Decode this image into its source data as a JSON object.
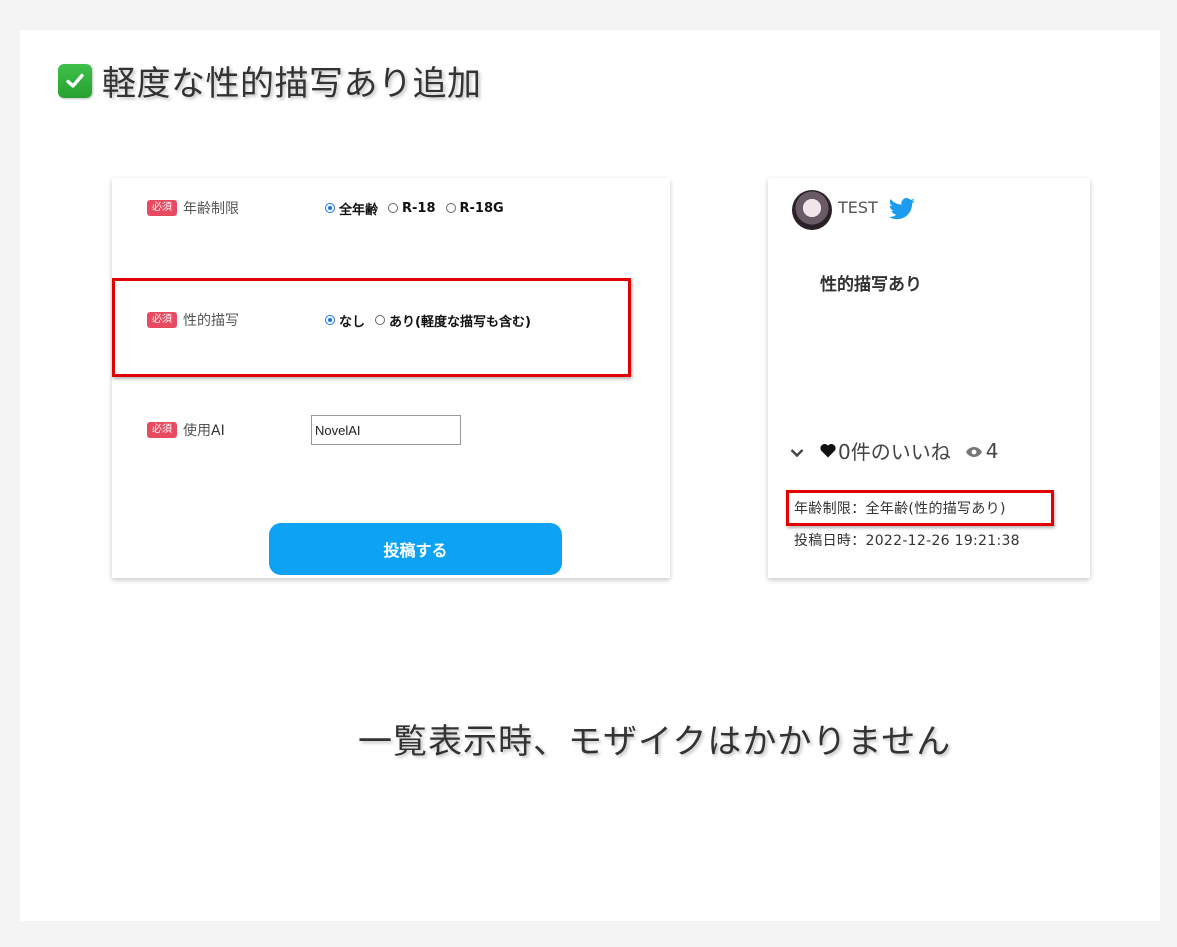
{
  "slide": {
    "title": "軽度な性的描写あり追加",
    "caption": "一覧表示時、モザイクはかかりません"
  },
  "form": {
    "required_badge": "必須",
    "age_restriction": {
      "label": "年齢制限",
      "options": [
        "全年齢",
        "R-18",
        "R-18G"
      ],
      "selected": "全年齢"
    },
    "sexual_content": {
      "label": "性的描写",
      "options": [
        "なし",
        "あり(軽度な描写も含む)"
      ],
      "selected": "なし"
    },
    "ai_used": {
      "label_prefix": "使用",
      "label_suffix": "AI",
      "value": "NovelAI"
    },
    "submit_label": "投稿する"
  },
  "post": {
    "username": "TEST",
    "title": "性的描写あり",
    "likes_text": "0件のいいね",
    "views": "4",
    "age_info": "年齢制限：全年齢(性的描写あり)",
    "posted_at": "投稿日時：2022-12-26 19:21:38"
  },
  "colors": {
    "accent": "#0ea2f4",
    "required_badge": "#e84a5f",
    "highlight": "#e30000",
    "twitter": "#1d9bf0",
    "check": "#2eb33a"
  },
  "icons": [
    "check-icon",
    "twitter-icon",
    "chevron-down-icon",
    "heart-icon",
    "eye-icon"
  ]
}
